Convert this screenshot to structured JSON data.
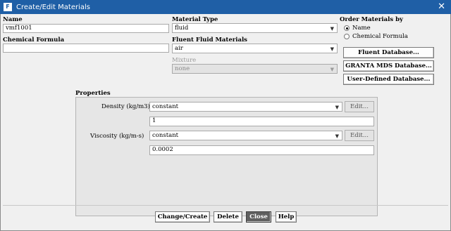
{
  "window": {
    "title": "Create/Edit Materials",
    "icon_glyph": "F",
    "close_glyph": "✕"
  },
  "name": {
    "label": "Name",
    "value": "vmf1001"
  },
  "chemical_formula": {
    "label": "Chemical Formula",
    "value": ""
  },
  "material_type": {
    "label": "Material Type",
    "value": "fluid"
  },
  "fluent_fluid_materials": {
    "label": "Fluent Fluid Materials",
    "value": "air"
  },
  "mixture": {
    "label": "Mixture",
    "value": "none"
  },
  "order_by": {
    "label": "Order Materials by",
    "options": [
      {
        "label": "Name",
        "selected": true
      },
      {
        "label": "Chemical Formula",
        "selected": false
      }
    ]
  },
  "database_buttons": {
    "fluent": "Fluent Database...",
    "granta": "GRANTA MDS Database...",
    "user": "User-Defined Database..."
  },
  "properties": {
    "heading": "Properties",
    "density": {
      "label": "Density (kg/m3)",
      "method": "constant",
      "edit": "Edit...",
      "value": "1"
    },
    "viscosity": {
      "label": "Viscosity (kg/m-s)",
      "method": "constant",
      "edit": "Edit...",
      "value": "0.0002"
    }
  },
  "footer": {
    "change_create": "Change/Create",
    "delete": "Delete",
    "close": "Close",
    "help": "Help"
  },
  "dropdown_glyph": "▼"
}
